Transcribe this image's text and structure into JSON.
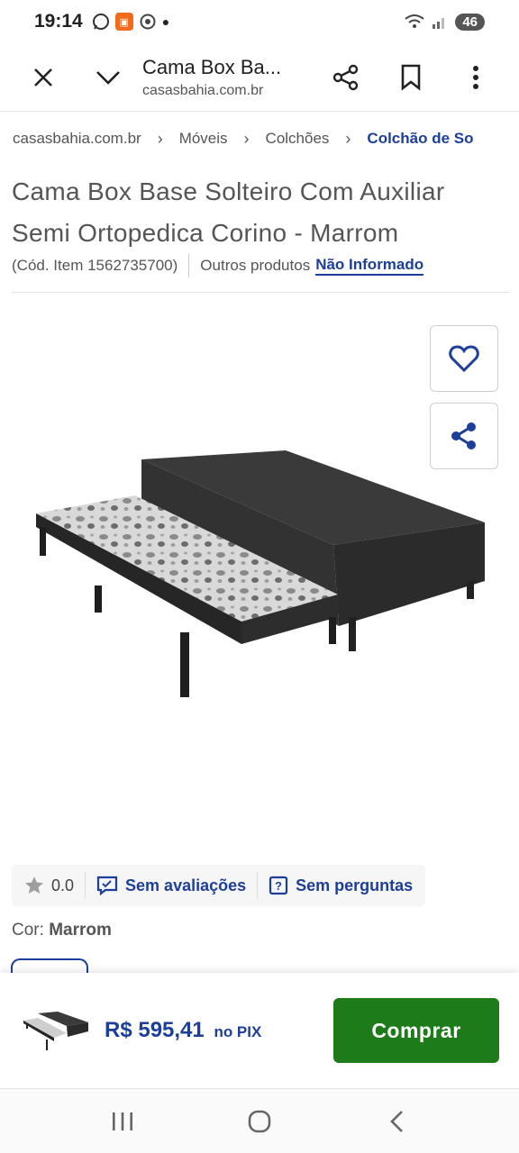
{
  "status_bar": {
    "time": "19:14",
    "battery": "46"
  },
  "browser": {
    "page_title": "Cama Box Ba...",
    "url": "casasbahia.com.br"
  },
  "breadcrumb": {
    "items": [
      "casasbahia.com.br",
      "Móveis",
      "Colchões"
    ],
    "current": "Colchão de So"
  },
  "product": {
    "title": "Cama Box Base Solteiro Com Auxiliar Semi Ortopedica Corino - Marrom",
    "item_code": "(Cód. Item 1562735700)",
    "others_label": "Outros produtos",
    "others_link": "Não Informado"
  },
  "rating": {
    "score": "0.0",
    "reviews_label": "Sem avaliações",
    "questions_label": "Sem perguntas"
  },
  "color": {
    "label": "Cor:",
    "value": "Marrom"
  },
  "buy_bar": {
    "price": "R$ 595,41",
    "price_suffix": "no PIX",
    "buy_label": "Comprar"
  },
  "colors": {
    "brand_blue": "#1d3f9a",
    "buy_green": "#1d7b1a"
  }
}
